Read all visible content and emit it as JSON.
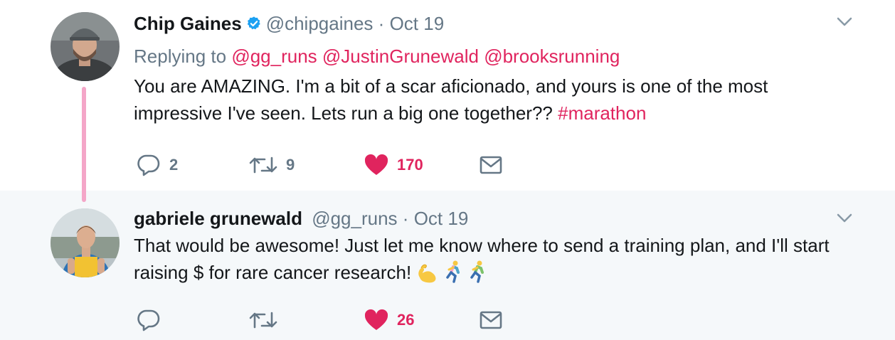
{
  "tweets": [
    {
      "name": "Chip Gaines",
      "verified": true,
      "handle": "@chipgaines",
      "separator": "·",
      "date": "Oct 19",
      "replying_prefix": "Replying to",
      "replying_to": [
        "@gg_runs",
        "@JustinGrunewald",
        "@brooksrunning"
      ],
      "text_parts": [
        "You are AMAZING. I'm a bit of a scar aficionado, and yours is one of the most impressive I've seen. Lets run a big one together?? "
      ],
      "hashtag": "#marathon",
      "reply_count": "2",
      "retweet_count": "9",
      "like_count": "170"
    },
    {
      "name": "gabriele grunewald",
      "handle": "@gg_runs",
      "separator": "·",
      "date": "Oct 19",
      "text": "That would be awesome! Just let me know where to send a training plan, and I'll start raising $ for rare cancer research!",
      "emojis": [
        "flexed-biceps",
        "person-running",
        "person-running"
      ],
      "like_count": "26"
    }
  ],
  "colors": {
    "link": "#e0245e",
    "secondary_text": "#657786",
    "thread_line": "#f4a6c8",
    "reply_background": "#f5f8fa",
    "verified": "#1da1f2"
  }
}
